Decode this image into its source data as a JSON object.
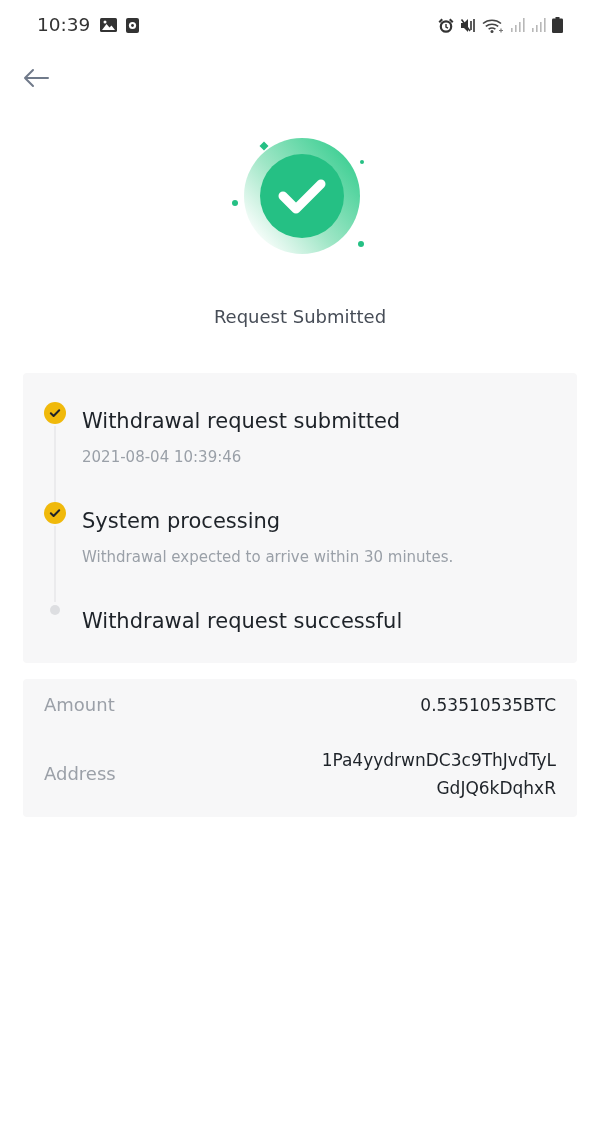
{
  "status_bar": {
    "time": "10:39"
  },
  "header": {
    "title": "Request Submitted"
  },
  "timeline": {
    "steps": [
      {
        "title": "Withdrawal request submitted",
        "detail": "2021-08-04 10:39:46",
        "done": true
      },
      {
        "title": "System processing",
        "detail": "Withdrawal expected to arrive within 30 minutes.",
        "done": true
      },
      {
        "title": "Withdrawal request successful",
        "done": false
      }
    ]
  },
  "details": [
    {
      "label": "Amount",
      "value": "0.53510535BTC"
    },
    {
      "label": "Address",
      "value": "1Pa4yydrwnDC3c9ThJvdTyLGdJQ6kDqhxR"
    }
  ]
}
